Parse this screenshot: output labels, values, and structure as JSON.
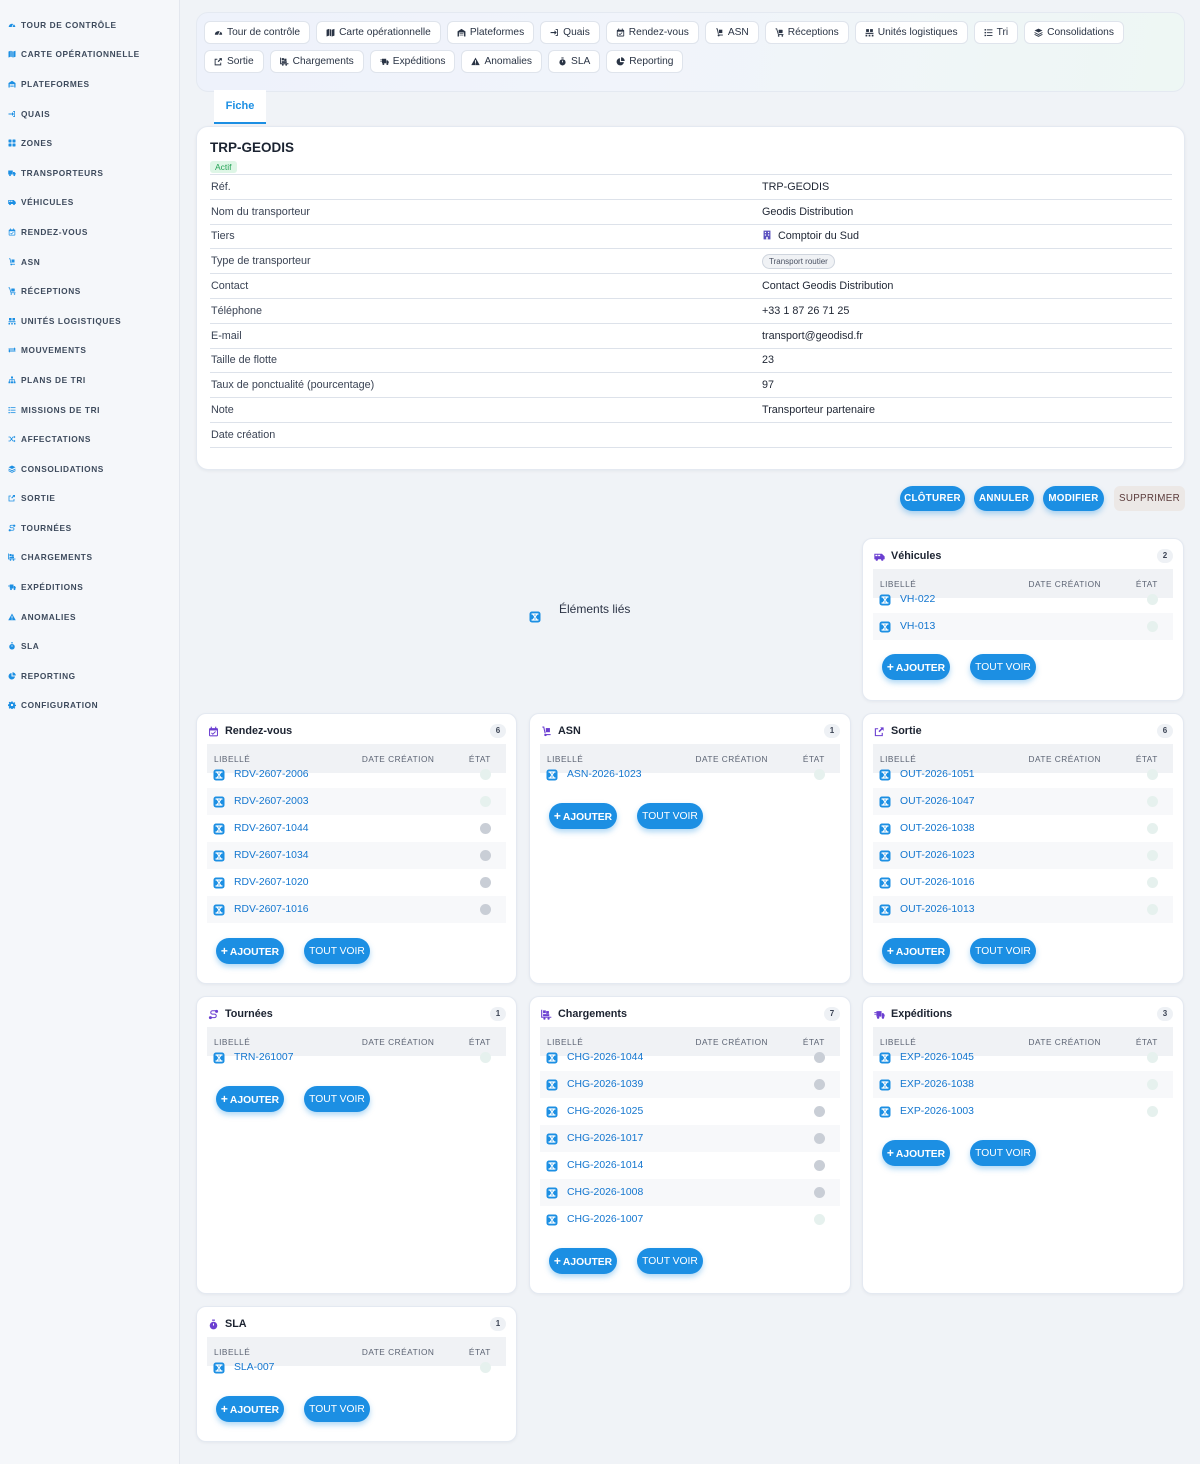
{
  "sidebar": {
    "items": [
      {
        "label": "TOUR DE CONTRÔLE",
        "icon": "gauge-icon"
      },
      {
        "label": "CARTE OPÉRATIONNELLE",
        "icon": "map-icon"
      },
      {
        "label": "PLATEFORMES",
        "icon": "warehouse-icon"
      },
      {
        "label": "QUAIS",
        "icon": "sign-in-icon"
      },
      {
        "label": "ZONES",
        "icon": "grid-icon"
      },
      {
        "label": "TRANSPORTEURS",
        "icon": "truck-icon"
      },
      {
        "label": "VÉHICULES",
        "icon": "van-icon"
      },
      {
        "label": "RENDEZ-VOUS",
        "icon": "calendar-icon"
      },
      {
        "label": "ASN",
        "icon": "dolly-icon"
      },
      {
        "label": "RÉCEPTIONS",
        "icon": "dolly-flatbed-icon"
      },
      {
        "label": "UNITÉS LOGISTIQUES",
        "icon": "pallet-icon"
      },
      {
        "label": "MOUVEMENTS",
        "icon": "exchange-icon"
      },
      {
        "label": "PLANS DE TRI",
        "icon": "sitemap-icon"
      },
      {
        "label": "MISSIONS DE TRI",
        "icon": "list-icon"
      },
      {
        "label": "AFFECTATIONS",
        "icon": "shuffle-icon"
      },
      {
        "label": "CONSOLIDATIONS",
        "icon": "layers-icon"
      },
      {
        "label": "SORTIE",
        "icon": "share-icon"
      },
      {
        "label": "TOURNÉES",
        "icon": "route-icon"
      },
      {
        "label": "CHARGEMENTS",
        "icon": "truck-loading-icon"
      },
      {
        "label": "EXPÉDITIONS",
        "icon": "shipping-fast-icon"
      },
      {
        "label": "ANOMALIES",
        "icon": "warning-icon"
      },
      {
        "label": "SLA",
        "icon": "stopwatch-icon"
      },
      {
        "label": "REPORTING",
        "icon": "pie-chart-icon"
      },
      {
        "label": "CONFIGURATION",
        "icon": "gear-icon"
      }
    ]
  },
  "quicknav": {
    "row1": [
      {
        "label": "Tour de contrôle",
        "icon": "gauge-icon"
      },
      {
        "label": "Carte opérationnelle",
        "icon": "map-icon"
      },
      {
        "label": "Plateformes",
        "icon": "warehouse-icon"
      },
      {
        "label": "Quais",
        "icon": "sign-in-icon"
      },
      {
        "label": "Rendez-vous",
        "icon": "calendar-icon"
      },
      {
        "label": "ASN",
        "icon": "dolly-icon"
      },
      {
        "label": "Réceptions",
        "icon": "dolly-flatbed-icon"
      },
      {
        "label": "Unités logistiques",
        "icon": "pallet-icon"
      },
      {
        "label": "Tri",
        "icon": "list-icon"
      },
      {
        "label": "Consolidations",
        "icon": "layers-icon"
      }
    ],
    "row2": [
      {
        "label": "Sortie",
        "icon": "share-icon"
      },
      {
        "label": "Chargements",
        "icon": "truck-loading-icon"
      },
      {
        "label": "Expéditions",
        "icon": "shipping-fast-icon"
      },
      {
        "label": "Anomalies",
        "icon": "warning-icon"
      },
      {
        "label": "SLA",
        "icon": "stopwatch-icon"
      },
      {
        "label": "Reporting",
        "icon": "pie-chart-icon"
      }
    ]
  },
  "tab": {
    "label": "Fiche"
  },
  "record": {
    "title": "TRP-GEODIS",
    "status": "Actif",
    "fields": [
      {
        "label": "Réf.",
        "value": "TRP-GEODIS"
      },
      {
        "label": "Nom du transporteur",
        "value": "Geodis Distribution"
      },
      {
        "label": "Tiers",
        "value": "Comptoir du Sud",
        "type": "link",
        "icon": "building-icon"
      },
      {
        "label": "Type de transporteur",
        "value": "Transport routier",
        "type": "pill"
      },
      {
        "label": "Contact",
        "value": "Contact Geodis Distribution"
      },
      {
        "label": "Téléphone",
        "value": "+33 1 87 26 71 25"
      },
      {
        "label": "E-mail",
        "value": "transport@geodisd.fr"
      },
      {
        "label": "Taille de flotte",
        "value": "23"
      },
      {
        "label": "Taux de ponctualité (pourcentage)",
        "value": "97"
      },
      {
        "label": "Note",
        "value": "Transporteur partenaire"
      },
      {
        "label": "Date création",
        "value": ""
      }
    ]
  },
  "actions": {
    "close": "CLÔTURER",
    "cancel": "ANNULER",
    "edit": "MODIFIER",
    "delete": "SUPPRIMER"
  },
  "linked": {
    "label": "Éléments liés"
  },
  "table_headers": {
    "label": "LIBELLÉ",
    "date": "DATE CRÉATION",
    "state": "ÉTAT"
  },
  "card_buttons": {
    "add": "AJOUTER",
    "all": "TOUT VOIR"
  },
  "colors": {
    "accent": "#1c8fe3",
    "card_icon": "#6b3fd1",
    "status_gray": "#c9ced6",
    "status_light": "#e6f1ee"
  },
  "cards": [
    {
      "key": "vehicules",
      "title": "Véhicules",
      "count": "2",
      "icon": "van-icon",
      "rows": [
        {
          "label": "VH-022",
          "state": "light"
        },
        {
          "label": "VH-013",
          "state": "light"
        }
      ]
    },
    {
      "key": "rdv",
      "title": "Rendez-vous",
      "count": "6",
      "icon": "calendar-icon",
      "rows": [
        {
          "label": "RDV-2607-2006",
          "state": "light"
        },
        {
          "label": "RDV-2607-2003",
          "state": "light"
        },
        {
          "label": "RDV-2607-1044",
          "state": "gray"
        },
        {
          "label": "RDV-2607-1034",
          "state": "gray"
        },
        {
          "label": "RDV-2607-1020",
          "state": "gray"
        },
        {
          "label": "RDV-2607-1016",
          "state": "gray"
        }
      ]
    },
    {
      "key": "asn",
      "title": "ASN",
      "count": "1",
      "icon": "dolly-icon",
      "rows": [
        {
          "label": "ASN-2026-1023",
          "state": "light"
        }
      ]
    },
    {
      "key": "sortie",
      "title": "Sortie",
      "count": "6",
      "icon": "share-icon",
      "rows": [
        {
          "label": "OUT-2026-1051",
          "state": "light"
        },
        {
          "label": "OUT-2026-1047",
          "state": "light"
        },
        {
          "label": "OUT-2026-1038",
          "state": "light"
        },
        {
          "label": "OUT-2026-1023",
          "state": "light"
        },
        {
          "label": "OUT-2026-1016",
          "state": "light"
        },
        {
          "label": "OUT-2026-1013",
          "state": "light"
        }
      ]
    },
    {
      "key": "tournees",
      "title": "Tournées",
      "count": "1",
      "icon": "route-icon",
      "rows": [
        {
          "label": "TRN-261007",
          "state": "light"
        }
      ]
    },
    {
      "key": "chargements",
      "title": "Chargements",
      "count": "7",
      "icon": "truck-loading-icon",
      "rows": [
        {
          "label": "CHG-2026-1044",
          "state": "gray"
        },
        {
          "label": "CHG-2026-1039",
          "state": "gray"
        },
        {
          "label": "CHG-2026-1025",
          "state": "gray"
        },
        {
          "label": "CHG-2026-1017",
          "state": "gray"
        },
        {
          "label": "CHG-2026-1014",
          "state": "gray"
        },
        {
          "label": "CHG-2026-1008",
          "state": "gray"
        },
        {
          "label": "CHG-2026-1007",
          "state": "light"
        }
      ]
    },
    {
      "key": "expeditions",
      "title": "Expéditions",
      "count": "3",
      "icon": "shipping-fast-icon",
      "rows": [
        {
          "label": "EXP-2026-1045",
          "state": "light"
        },
        {
          "label": "EXP-2026-1038",
          "state": "light"
        },
        {
          "label": "EXP-2026-1003",
          "state": "light"
        }
      ]
    },
    {
      "key": "sla",
      "title": "SLA",
      "count": "1",
      "icon": "stopwatch-icon",
      "rows": [
        {
          "label": "SLA-007",
          "state": "light"
        }
      ]
    }
  ]
}
